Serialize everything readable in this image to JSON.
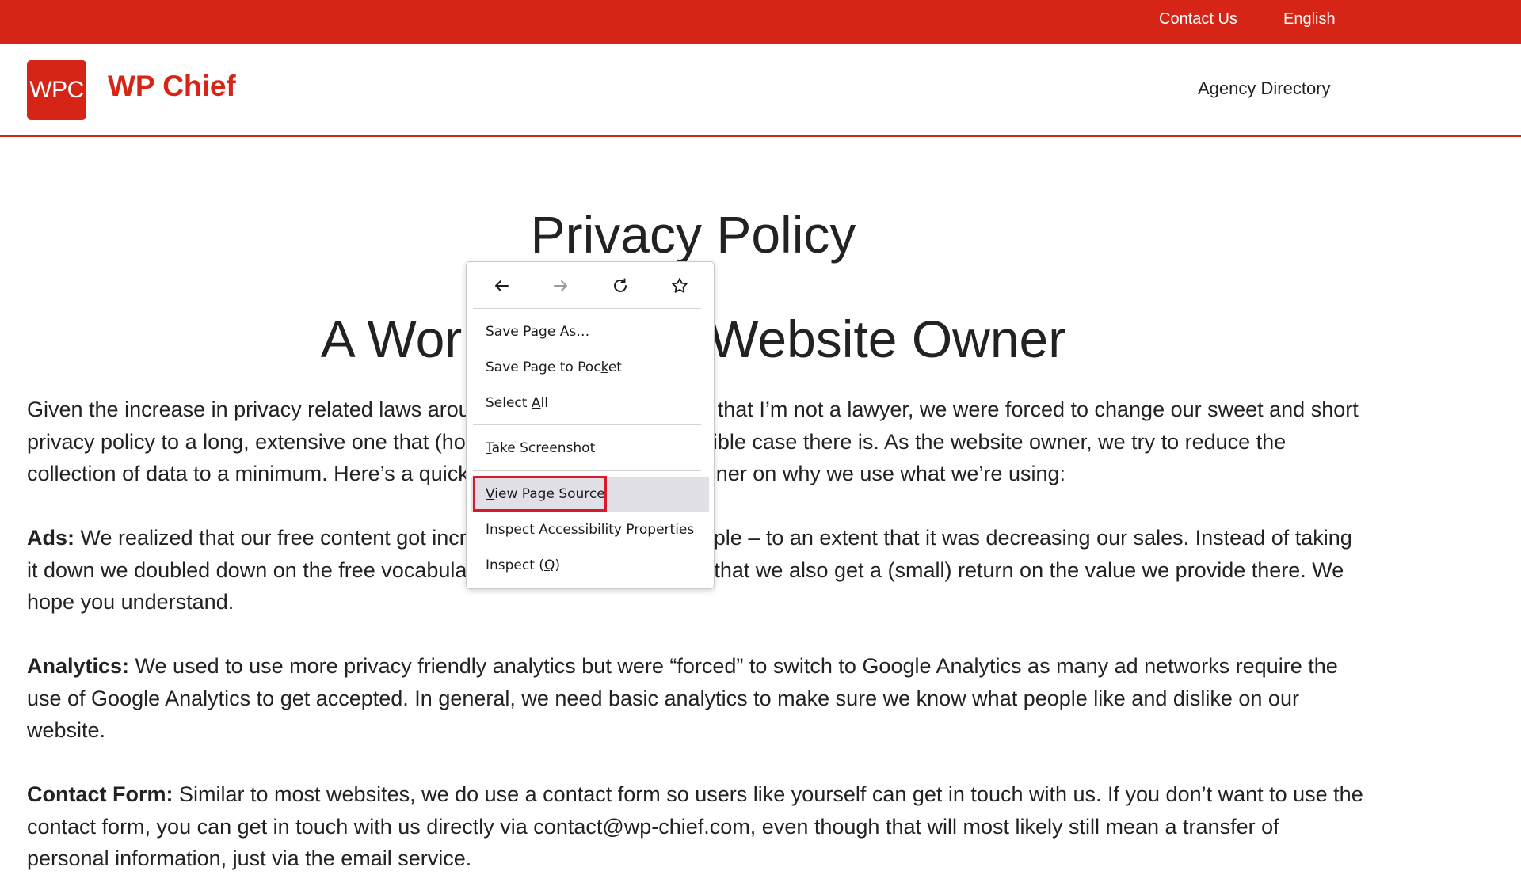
{
  "topbar": {
    "contact": "Contact Us",
    "language": "English"
  },
  "header": {
    "logo": "WPC",
    "brand": "WP Chief",
    "nav_agency": "Agency Directory"
  },
  "content": {
    "title": "Privacy Policy",
    "subtitle_left": "A Wor",
    "subtitle_right": "Website Owner",
    "p1_line1_left": "Given the increase in privacy related laws arou",
    "p1_line1_right": "that I’m not a lawyer, we were forced to change our sweet and short",
    "p1_line2_left": "privacy policy to a long, extensive one that (ho",
    "p1_line2_right": "ible case there is. As the website owner, we try to reduce the",
    "p1_line3_left": "collection of data to a minimum. Here’s a quick",
    "p1_line3_right": "ner on why we use what we’re using:",
    "ads_label": "Ads:",
    "p2_line1_left": " We realized that our free content got incr",
    "p2_line1_right": "ple – to an extent that it was decreasing our sales. Instead of taking",
    "p2_line2_left": "it down we doubled down on the free vocabula",
    "p2_line2_right": "that we also get a (small) return on the value we provide there. We",
    "p2_line3": "hope you understand.",
    "analytics_label": "Analytics:",
    "p3_text": " We used to use more privacy friendly analytics but were “forced” to switch to Google Analytics as many ad networks require the use of Google Analytics to get accepted. In general, we need basic analytics to make sure we know what people like and dislike on our website.",
    "contact_label": "Contact Form:",
    "p4_text": " Similar to most websites, we do use a contact form so users like yourself can get in touch with us. If you don’t want to use the contact form, you can get in touch with us directly via contact@wp-chief.com, even though that will most likely still mean a transfer of personal information, just via the email service."
  },
  "context_menu": {
    "items": [
      {
        "pre": "Save ",
        "key": "P",
        "post": "age As…"
      },
      {
        "pre": "Save Page to Poc",
        "key": "k",
        "post": "et"
      },
      {
        "pre": "Select ",
        "key": "A",
        "post": "ll"
      },
      {
        "pre": "",
        "key": "T",
        "post": "ake Screenshot"
      },
      {
        "pre": "",
        "key": "V",
        "post": "iew Page Source"
      },
      {
        "pre": "Inspect Accessibility Properties",
        "key": "",
        "post": ""
      },
      {
        "pre": "Inspect (",
        "key": "Q",
        "post": ")"
      }
    ],
    "icons": [
      "back-arrow-icon",
      "forward-arrow-icon",
      "reload-icon",
      "bookmark-star-icon"
    ],
    "highlight_color": "#d9192c"
  },
  "colors": {
    "brand_red": "#d62416"
  }
}
